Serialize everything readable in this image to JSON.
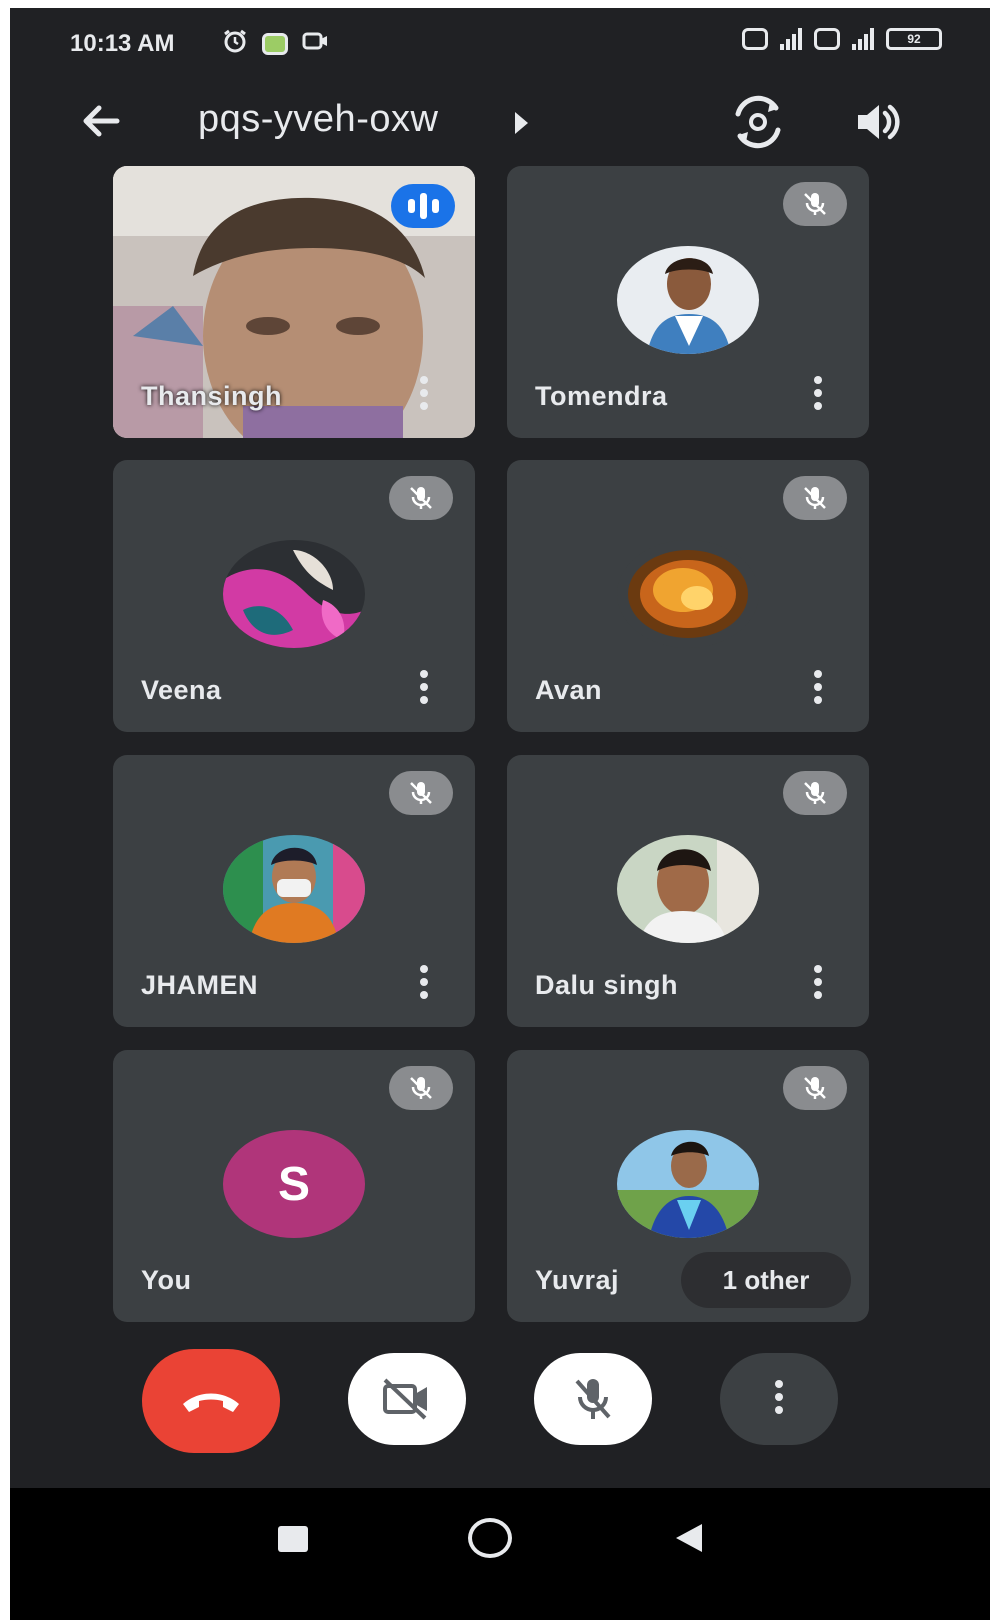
{
  "status_bar": {
    "time": "10:13 AM",
    "battery": "92",
    "icons": [
      "alarm-icon",
      "app-notification-icon",
      "screen-record-icon",
      "sim1-signal-icon",
      "sim2-signal-icon",
      "battery-icon"
    ]
  },
  "header": {
    "meeting_code": "pqs-yveh-oxw",
    "icons": [
      "back-arrow-icon",
      "expand-caret-icon",
      "switch-camera-icon",
      "speaker-icon"
    ]
  },
  "participants": [
    {
      "name": "Thansingh",
      "state": "speaking"
    },
    {
      "name": "Tomendra",
      "state": "muted"
    },
    {
      "name": "Veena",
      "state": "muted"
    },
    {
      "name": "Avan",
      "state": "muted"
    },
    {
      "name": "JHAMEN",
      "state": "muted"
    },
    {
      "name": "Dalu singh",
      "state": "muted"
    },
    {
      "name": "You",
      "state": "muted",
      "initial": "S",
      "avatar_color": "#b0357a"
    },
    {
      "name": "Yuvraj",
      "state": "muted",
      "extra": "1 other"
    }
  ],
  "controls": [
    "end-call-button",
    "camera-off-button",
    "mic-off-button",
    "more-options-button"
  ],
  "colors": {
    "background": "#202124",
    "tile": "#3c4043",
    "end_call": "#ea4335",
    "speaking": "#1a73e8"
  }
}
